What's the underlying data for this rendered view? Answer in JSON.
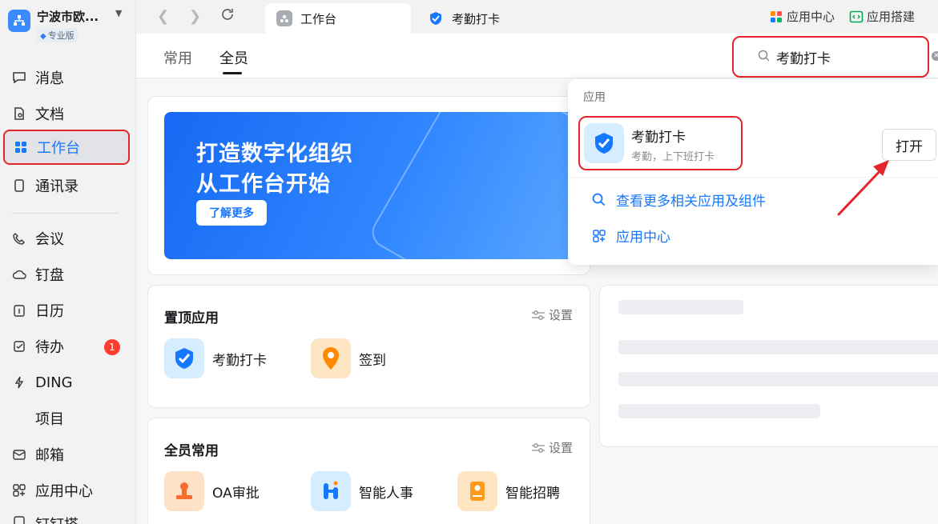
{
  "org": {
    "name": "宁波市欧...",
    "edition": "专业版"
  },
  "nav": {
    "items": [
      {
        "label": "消息",
        "icon": "message-icon"
      },
      {
        "label": "文档",
        "icon": "document-icon"
      },
      {
        "label": "工作台",
        "icon": "workbench-icon",
        "active": true
      },
      {
        "label": "通讯录",
        "icon": "contacts-icon"
      },
      {
        "label": "会议",
        "icon": "meeting-icon"
      },
      {
        "label": "钉盘",
        "icon": "cloud-drive-icon"
      },
      {
        "label": "日历",
        "icon": "calendar-icon"
      },
      {
        "label": "待办",
        "icon": "todo-icon",
        "badge": "1"
      },
      {
        "label": "DING",
        "icon": "ding-icon"
      },
      {
        "label": "项目",
        "icon": "project-icon"
      },
      {
        "label": "邮箱",
        "icon": "mail-icon"
      },
      {
        "label": "应用中心",
        "icon": "app-center-icon"
      },
      {
        "label": "钉钉搭",
        "icon": "builder-icon"
      }
    ]
  },
  "topbar": {
    "tabs": [
      {
        "label": "工作台",
        "active": true
      },
      {
        "label": "考勤打卡",
        "active": false
      }
    ],
    "app_center": "应用中心",
    "app_builder": "应用搭建"
  },
  "subnav": {
    "tabs": [
      "常用",
      "全员"
    ],
    "active": "全员"
  },
  "search": {
    "value": "考勤打卡"
  },
  "banner": {
    "line1": "打造数字化组织",
    "line2": "从工作台开始",
    "button": "了解更多"
  },
  "pinned": {
    "title": "置顶应用",
    "settings": "设置",
    "apps": [
      "考勤打卡",
      "签到"
    ]
  },
  "common": {
    "title": "全员常用",
    "settings": "设置",
    "apps": [
      "OA审批",
      "智能人事",
      "智能招聘"
    ]
  },
  "dropdown": {
    "section": "应用",
    "result": {
      "name": "考勤打卡",
      "desc": "考勤，上下班打卡"
    },
    "open_button": "打开",
    "more_link": "查看更多相关应用及组件",
    "app_center_link": "应用中心"
  },
  "colors": {
    "accent": "#1677ff",
    "highlight": "#e3262c",
    "badge": "#ff3b30"
  }
}
